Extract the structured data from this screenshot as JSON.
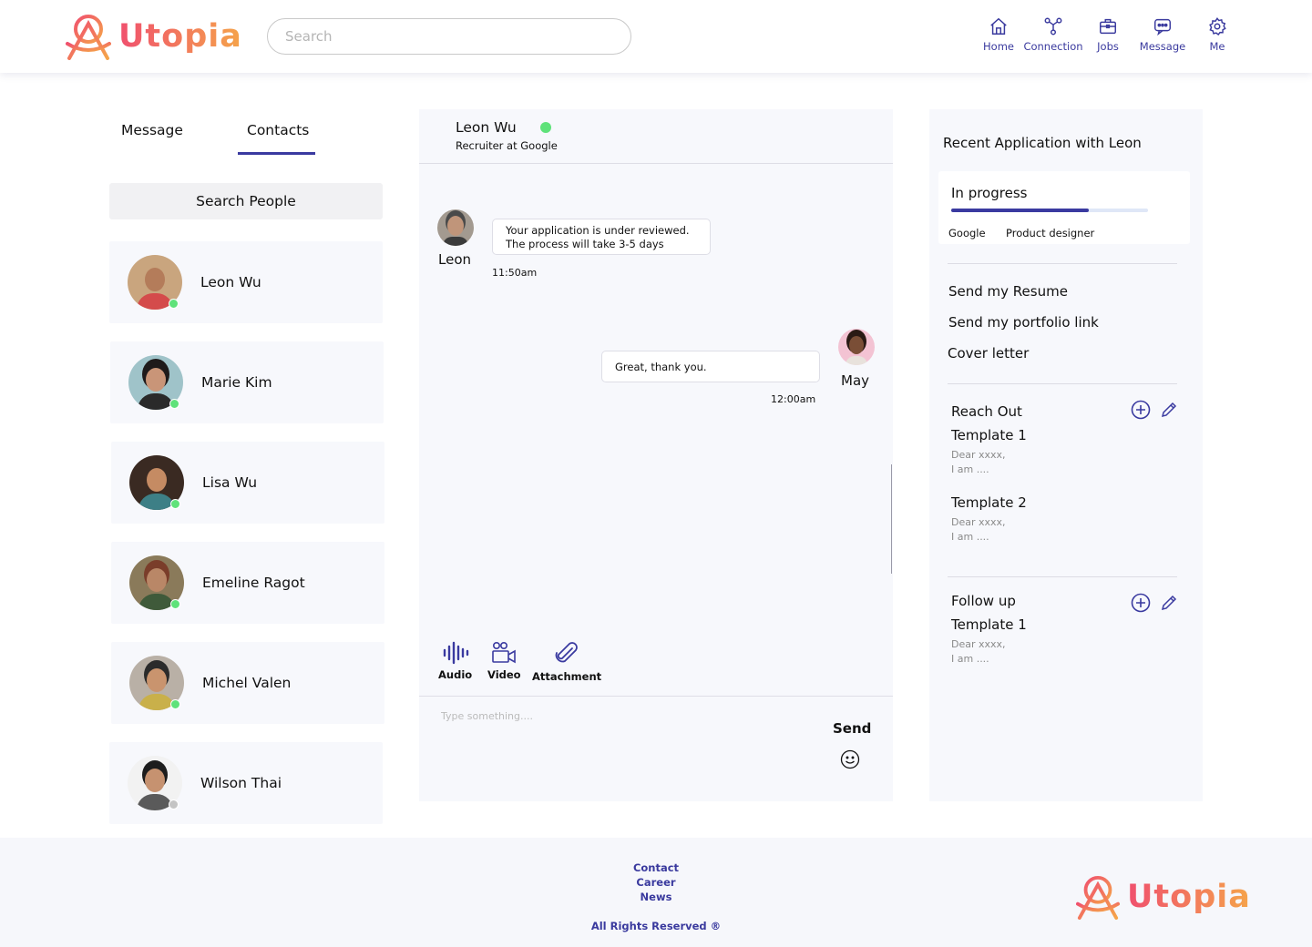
{
  "brand": {
    "name": "Utopia"
  },
  "search": {
    "placeholder": "Search"
  },
  "nav": [
    {
      "label": "Home",
      "icon": "home-icon"
    },
    {
      "label": "Connection",
      "icon": "connection-icon"
    },
    {
      "label": "Jobs",
      "icon": "jobs-icon"
    },
    {
      "label": "Message",
      "icon": "message-icon"
    },
    {
      "label": "Me",
      "icon": "gear-icon"
    }
  ],
  "tabs": {
    "message": "Message",
    "contacts": "Contacts",
    "active": "Contacts"
  },
  "search_people": "Search People",
  "contacts": [
    {
      "name": "Leon Wu",
      "online": true
    },
    {
      "name": "Marie Kim",
      "online": true
    },
    {
      "name": "Lisa Wu",
      "online": true
    },
    {
      "name": "Emeline Ragot",
      "online": true
    },
    {
      "name": "Michel Valen",
      "online": true
    },
    {
      "name": "Wilson Thai",
      "online": false
    }
  ],
  "chat": {
    "name": "Leon Wu",
    "subtitle": "Recruiter at Google",
    "online": true,
    "messages": [
      {
        "sender": "Leon",
        "line1": "Your application is under reviewed.",
        "line2": "The process will take 3-5 days",
        "time": "11:50am"
      },
      {
        "sender": "May",
        "text": "Great, thank you.",
        "time": "12:00am"
      }
    ],
    "tools": {
      "audio": "Audio",
      "video": "Video",
      "attachment": "Attachment"
    },
    "input_placeholder": "Type something....",
    "send": "Send"
  },
  "side": {
    "title": "Recent Application with Leon",
    "app": {
      "status": "In progress",
      "progress": 0.7,
      "company": "Google",
      "role": "Product designer"
    },
    "actions": [
      "Send my Resume",
      "Send my portfolio link",
      "Cover letter"
    ],
    "reach_out": {
      "title": "Reach Out",
      "templates": [
        {
          "name": "Template 1",
          "line1": "Dear xxxx,",
          "line2": "I am ...."
        },
        {
          "name": "Template 2",
          "line1": "Dear xxxx,",
          "line2": "I am ...."
        }
      ]
    },
    "follow_up": {
      "title": "Follow up",
      "templates": [
        {
          "name": "Template 1",
          "line1": "Dear xxxx,",
          "line2": "I am ...."
        }
      ]
    }
  },
  "footer": {
    "links": [
      "Contact",
      "Career",
      "News"
    ],
    "rights": "All Rights Reserved ®",
    "brand": "Utopia"
  },
  "colors": {
    "accent": "#3a3aa0",
    "online": "#5fe27a",
    "offline": "#c4c4c4",
    "logo_start": "#f0506e",
    "logo_end": "#f5a44a"
  }
}
